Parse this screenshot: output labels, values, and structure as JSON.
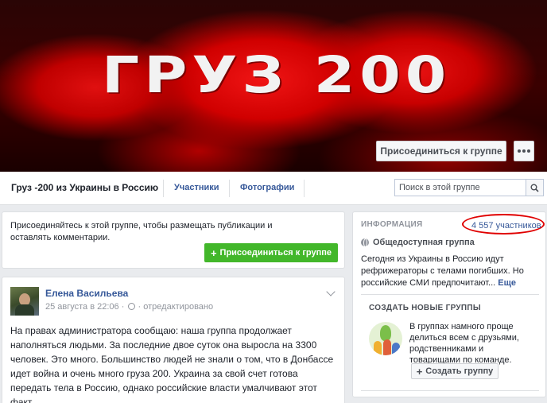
{
  "cover": {
    "title": "ГРУЗ 200",
    "join_button": "Присоединиться к группе",
    "more_icon": "ellipsis-icon"
  },
  "nav": {
    "group_name": "Груз -200 из Украины в Россию",
    "tabs": [
      {
        "label": "Участники"
      },
      {
        "label": "Фотографии"
      }
    ],
    "search_placeholder": "Поиск в этой группе",
    "search_icon": "search-icon"
  },
  "join_card": {
    "text": "Присоединяйтесь к этой группе, чтобы размещать публикации и оставлять комментарии.",
    "button": "Присоединиться к группе",
    "button_icon": "plus-icon",
    "button_color": "#42b72a"
  },
  "post": {
    "author": "Елена Васильева",
    "date": "25 августа в 22:06",
    "separator": "·",
    "edited": "отредактировано",
    "body": "На правах администратора сообщаю: наша группа продолжает наполняться людьми. За последние двое суток она выросла на 3300 человек. Это много. Большинство людей не знали о том, что в Донбассе идет война и очень много груза 200. Украина за свой счет готова передать тела в Россию, однако российские власти умалчивают этот факт."
  },
  "info": {
    "header": "ИНФОРМАЦИЯ",
    "members": "4 557 участников",
    "privacy": "Общедоступная группа",
    "description": "Сегодня из Украины в Россию идут рефрижераторы с телами погибших. Но российские СМИ предпочитают...",
    "more_link": "Еще",
    "highlight_color": "#e00000"
  },
  "create": {
    "header": "СОЗДАТЬ НОВЫЕ ГРУППЫ",
    "description": "В группах намного проще делиться всем с друзьями, родственниками и товарищами по команде.",
    "button": "Создать группу"
  },
  "colors": {
    "link": "#365899",
    "background": "#e9ebee",
    "cover_red": "#d00000"
  }
}
